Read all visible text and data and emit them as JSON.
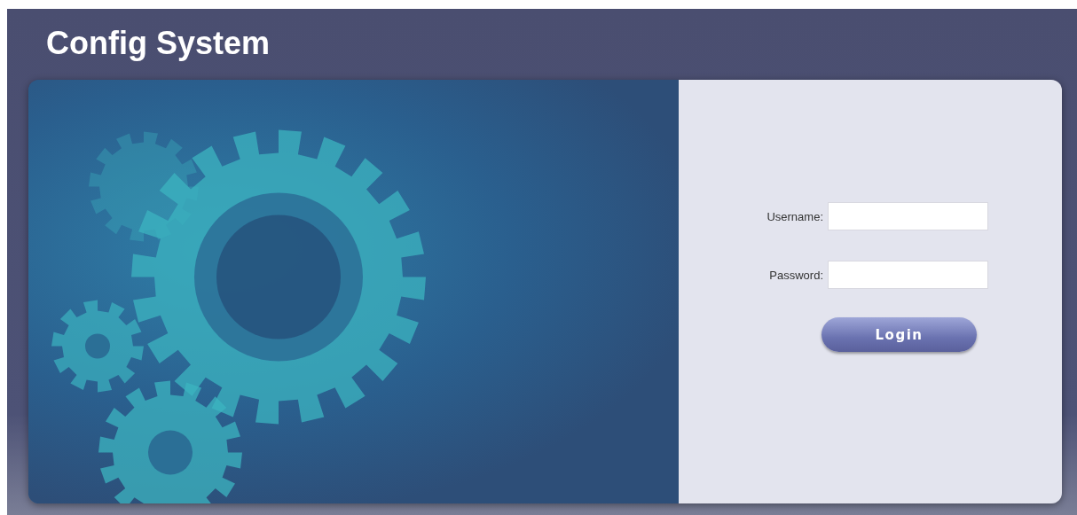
{
  "header": {
    "title": "Config System"
  },
  "login_form": {
    "fields": [
      {
        "label": "Username:"
      },
      {
        "label": "Password:"
      }
    ],
    "button": "Login"
  }
}
